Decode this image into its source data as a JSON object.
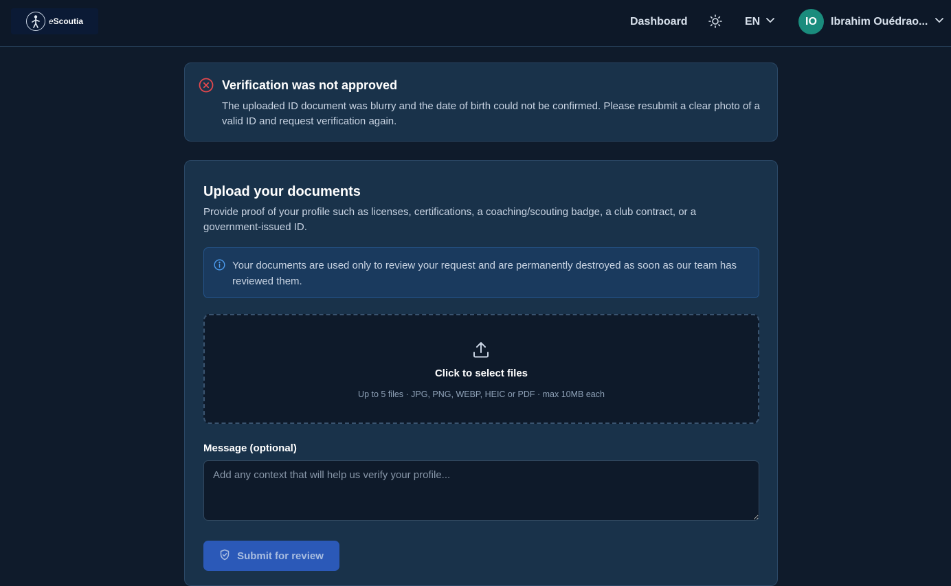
{
  "header": {
    "logo_text_prefix": "e",
    "logo_text_main": "Scoutia",
    "nav_dashboard": "Dashboard",
    "language": "EN",
    "user_initials": "IO",
    "user_name": "Ibrahim Ouédrao...",
    "avatar_color": "#1a8c7d"
  },
  "alert": {
    "title": "Verification was not approved",
    "body": "The uploaded ID document was blurry and the date of birth could not be confirmed. Please resubmit a clear photo of a valid ID and request verification again.",
    "icon": "x-circle-icon",
    "color": "#e5484d"
  },
  "upload": {
    "title": "Upload your documents",
    "description": "Provide proof of your profile such as licenses, certifications, a coaching/scouting badge, a club contract, or a government-issued ID.",
    "info_text": "Your documents are used only to review your request and are permanently destroyed as soon as our team has reviewed them.",
    "dropzone_title": "Click to select files",
    "dropzone_hint": "Up to 5 files · JPG, PNG, WEBP, HEIC or PDF · max 10MB each",
    "message_label": "Message (optional)",
    "message_placeholder": "Add any context that will help us verify your profile...",
    "message_value": "",
    "submit_label": "Submit for review",
    "accent_color": "#2b59b8"
  }
}
